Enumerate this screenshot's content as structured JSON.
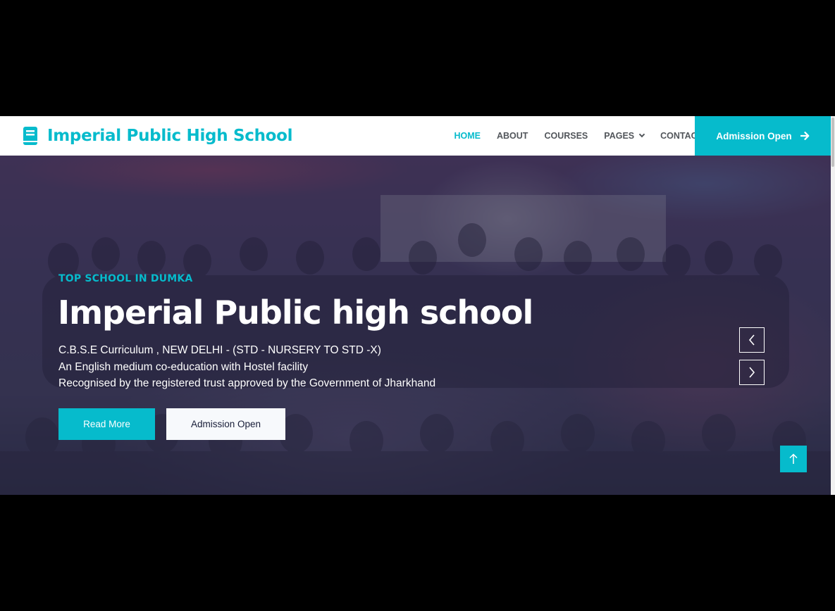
{
  "brand": {
    "name": "Imperial Public High School",
    "icon": "book-icon",
    "accent_color": "#06BBCC"
  },
  "nav": {
    "items": [
      {
        "label": "HOME",
        "active": true
      },
      {
        "label": "ABOUT",
        "active": false
      },
      {
        "label": "COURSES",
        "active": false
      },
      {
        "label": "PAGES",
        "active": false
      },
      {
        "label": "CONTACT",
        "active": false
      }
    ],
    "cta_label": "Admission Open"
  },
  "hero": {
    "eyebrow": "TOP SCHOOL IN DUMKA",
    "title": "Imperial Public high school",
    "lines": [
      "C.B.S.E Curriculum , NEW DELHI - (STD - NURSERY TO STD -X)",
      "An English medium co-education with Hostel facility",
      "Recognised by the registered trust approved by the Government of Jharkhand"
    ],
    "primary_button": "Read More",
    "secondary_button": "Admission Open"
  },
  "colors": {
    "primary": "#06BBCC",
    "dark": "#181D38",
    "nav_text": "#52565B"
  }
}
